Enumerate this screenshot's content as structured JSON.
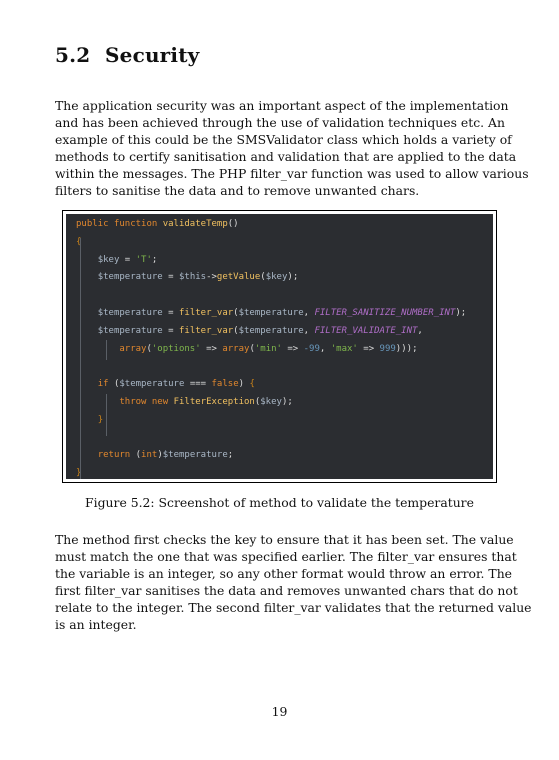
{
  "section": {
    "number": "5.2",
    "title": "Security"
  },
  "paragraph1": {
    "lines": [
      "The application security was an important aspect of the implementation",
      "and has been achieved through the use of validation techniques etc. An",
      "example of this could be the SMSValidator class which holds a variety of",
      "methods to certify sanitisation and validation that are applied to the data",
      "within the messages. The PHP filter_var function was used to allow various",
      "filters to sanitise the data and to remove unwanted chars."
    ]
  },
  "code": {
    "lines": [
      "public function validateTemp()",
      "{",
      "    $key = 'T';",
      "    $temperature = $this->getValue($key);",
      "",
      "    $temperature = filter_var($temperature, FILTER_SANITIZE_NUMBER_INT);",
      "    $temperature = filter_var($temperature, FILTER_VALIDATE_INT,",
      "        array('options' => array('min' => -99, 'max' => 999)));",
      "",
      "    if ($temperature === false) {",
      "        throw new FilterException($key);",
      "    }",
      "",
      "    return (int)$temperature;",
      "}"
    ]
  },
  "figure": {
    "caption": "Figure 5.2: Screenshot of method to validate the temperature"
  },
  "paragraph2": {
    "lines": [
      "The method first checks the key to ensure that it has been set. The value",
      "must match the one that was specified earlier. The filter_var ensures that",
      "the variable is an integer, so any other format would throw an error. The",
      "first filter_var sanitises the data and removes unwanted chars that do not",
      "relate to the integer. The second filter_var validates that the returned value",
      "is an integer."
    ]
  },
  "page_number": "19",
  "colors": {
    "code_background": "#2b2d31",
    "keyword": "#e0872e",
    "function_name": "#f0c060",
    "variable": "#a9b7c6",
    "string": "#7fb64c",
    "constant": "#b06ec9",
    "number": "#6897bb"
  }
}
